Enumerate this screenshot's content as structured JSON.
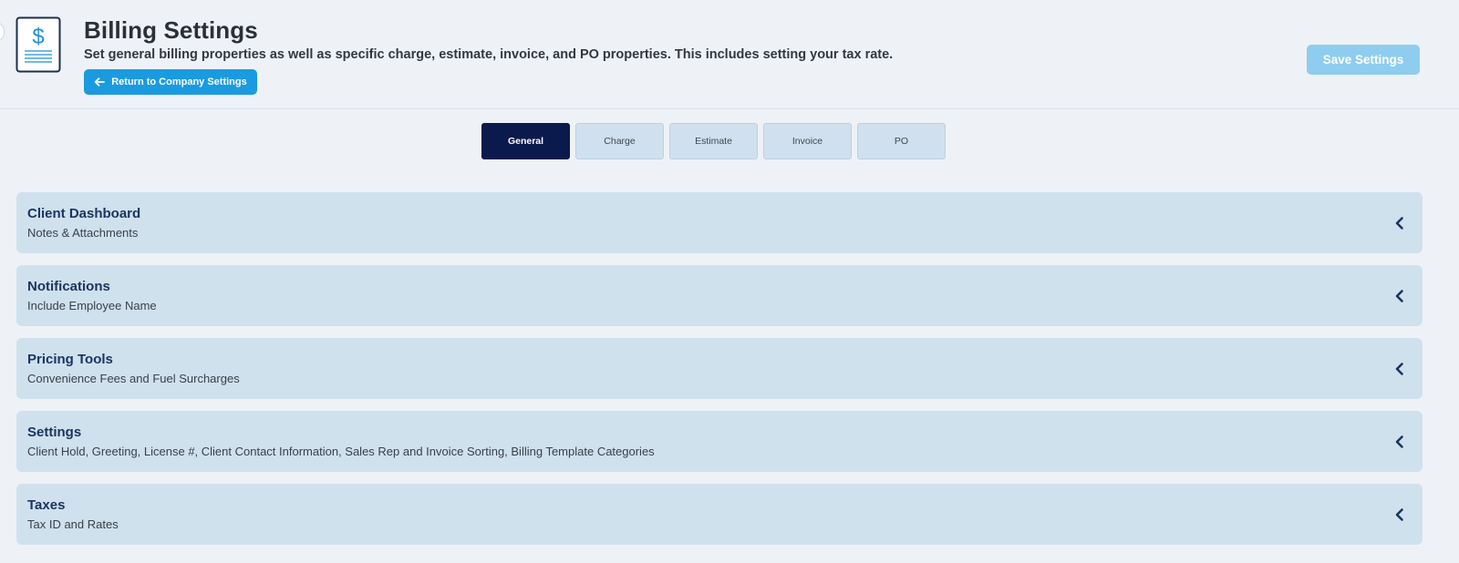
{
  "header": {
    "title": "Billing Settings",
    "subtitle": "Set general billing properties as well as specific charge, estimate, invoice, and PO properties. This includes setting your tax rate.",
    "return_button": "Return to Company Settings",
    "save_button": "Save Settings",
    "icon": "dollar-document-icon"
  },
  "tabs": [
    {
      "label": "General",
      "active": true
    },
    {
      "label": "Charge",
      "active": false
    },
    {
      "label": "Estimate",
      "active": false
    },
    {
      "label": "Invoice",
      "active": false
    },
    {
      "label": "PO",
      "active": false
    }
  ],
  "sections": [
    {
      "title": "Client Dashboard",
      "description": "Notes & Attachments"
    },
    {
      "title": "Notifications",
      "description": "Include Employee Name"
    },
    {
      "title": "Pricing Tools",
      "description": "Convenience Fees and Fuel Surcharges"
    },
    {
      "title": "Settings",
      "description": "Client Hold, Greeting, License #, Client Contact Information, Sales Rep and Invoice Sorting, Billing Template Categories"
    },
    {
      "title": "Taxes",
      "description": "Tax ID and Rates"
    }
  ],
  "colors": {
    "background": "#eef2f6",
    "accent": "#1a9be0",
    "save_disabled": "#8ecdf0",
    "tab_active": "#0b1a4d",
    "panel": "#d0e1ee",
    "panel_title": "#1a3560"
  }
}
